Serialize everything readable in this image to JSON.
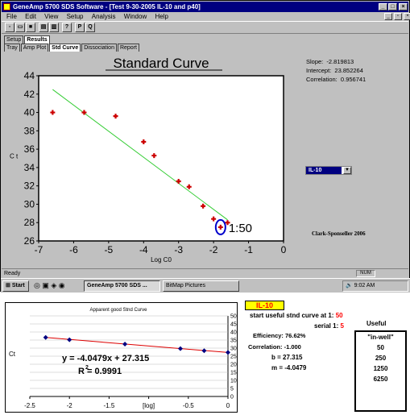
{
  "window": {
    "title": "GeneAmp 5700 SDS Software - [Test 9-30-2005 IL-10 and p40]",
    "menu": [
      "File",
      "Edit",
      "View",
      "Setup",
      "Analysis",
      "Window",
      "Help"
    ],
    "toolbar": [
      "new",
      "open",
      "save",
      "print-preview",
      "print",
      "help-pointer",
      "P",
      "Q"
    ],
    "tabs_row1": [
      "Setup",
      "Results"
    ],
    "tabs_row2": [
      "Tray",
      "Amp Plot",
      "Std Curve",
      "Dissociation",
      "Report"
    ],
    "active_tab_row2": "Std Curve",
    "status": "Ready",
    "num_indicator": "NUM"
  },
  "std_curve": {
    "title": "Standard Curve",
    "xlabel": "Log C0",
    "ylabel": "C t",
    "annotation": "1:50",
    "stats": {
      "slope": "Slope:  -2.819813",
      "intercept": "Intercept:  23.852264",
      "correlation": "Correlation:  0.956741"
    },
    "detector": "IL-10",
    "credit": "Clark-Sponseller 2006"
  },
  "taskbar": {
    "start": "Start",
    "item1": "GeneAmp 5700 SDS ...",
    "item2": "BitMap Pictures",
    "clock": "9:02 AM"
  },
  "chart_data": [
    {
      "type": "scatter",
      "title": "Standard Curve",
      "xlabel": "Log C0",
      "ylabel": "C t",
      "xlim": [
        -7,
        0
      ],
      "ylim": [
        26,
        44
      ],
      "xticks": [
        -7,
        -6,
        -5,
        -4,
        -3,
        -2,
        -1,
        0
      ],
      "yticks": [
        26,
        28,
        30,
        32,
        34,
        36,
        38,
        40,
        42,
        44
      ],
      "points": {
        "x": [
          -6.6,
          -5.7,
          -4.8,
          -4.0,
          -3.7,
          -3.0,
          -2.7,
          -2.3,
          -2.0,
          -1.8,
          -1.6
        ],
        "y": [
          40.0,
          40.0,
          39.6,
          36.8,
          35.3,
          32.5,
          31.9,
          29.8,
          28.4,
          27.5,
          28.0
        ]
      },
      "fit_line": {
        "x": [
          -6.6,
          -1.6
        ],
        "y": [
          42.5,
          28.3
        ]
      },
      "colors": {
        "points": "#cc0000",
        "fit": "#33cc33"
      }
    },
    {
      "type": "scatter",
      "title": "Apparent good Stnd Curve",
      "xlabel": "[log]",
      "ylabel": "Ct",
      "xlim": [
        -2.5,
        0
      ],
      "ylim": [
        0,
        50
      ],
      "xticks": [
        -2.5,
        -2,
        -1.5,
        -1,
        -0.5,
        0
      ],
      "xtick_labels": [
        "-2.5",
        "-2",
        "-1.5",
        "[log]",
        "-0.5",
        "0"
      ],
      "yticks": [
        0,
        5,
        10,
        15,
        20,
        25,
        30,
        35,
        40,
        45,
        50
      ],
      "points": {
        "x": [
          -2.3,
          -2.0,
          -1.3,
          -0.6,
          -0.3,
          0.0
        ],
        "y": [
          36.6,
          35.2,
          32.5,
          29.7,
          28.4,
          27.3
        ]
      },
      "equation": "y = -4.0479x + 27.315",
      "r_squared": "R  = 0.9991",
      "r_squared_sup": "2",
      "colors": {
        "points": "#000080",
        "fit": "#dd0000"
      }
    }
  ],
  "summary": {
    "il_label": "IL-10",
    "start_label": "start useful stnd curve at 1:",
    "start_value": "50",
    "serial_label": "serial 1:",
    "serial_value": "5",
    "efficiency": "Efficiency: 76.62%",
    "correlation": "Correlation: -1.000",
    "b": "b = 27.315",
    "m": "m = -4.0479",
    "useful_title": "Useful",
    "useful_list": [
      "\"in-well\"",
      "50",
      "250",
      "1250",
      "6250"
    ]
  }
}
